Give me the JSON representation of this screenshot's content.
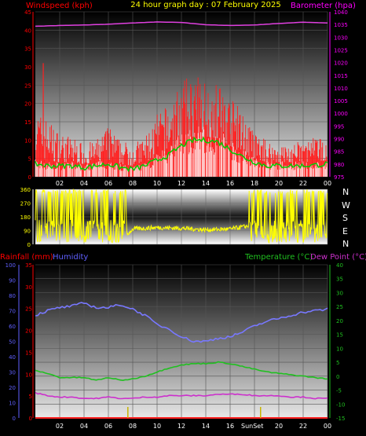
{
  "title": "24 hour graph day : 07 February 2025",
  "colors": {
    "wind": "#ff2020",
    "wind_avg": "#00cc00",
    "gust_fill": "#ffffff",
    "barometer": "#e040e0",
    "direction": "#ffff00",
    "humidity": "#7878ff",
    "temperature": "#20c020",
    "dewpoint": "#cc30cc",
    "rain": "#ff2020",
    "axis_left_top": "#ff0000",
    "axis_right_top": "#ff00ff",
    "axis_left_bottom_rain": "#ff0000",
    "axis_left_bottom_hum": "#6060ff",
    "axis_right_bottom": "#20c020",
    "xaxis": "#ffffff"
  },
  "labels": {
    "windspeed": "Windspeed (kph)",
    "barometer": "Barometer (hpa)",
    "rainfall": "Rainfall (mm)",
    "humidity": "Humidity",
    "temperature": "Temperature (°C)",
    "dewpoint": "Dew Point (°C)",
    "compass": [
      "N",
      "W",
      "S",
      "E",
      "N"
    ],
    "sunset": "SunSet"
  },
  "x_ticks": [
    "02",
    "04",
    "06",
    "08",
    "10",
    "12",
    "14",
    "16",
    "18",
    "20",
    "22",
    "00"
  ],
  "chart_data": [
    {
      "type": "line",
      "name": "wind-pressure",
      "x_range": [
        0,
        24
      ],
      "left_axis": {
        "label": "Windspeed (kph)",
        "ylim": [
          0,
          45
        ],
        "ticks": [
          0,
          5,
          10,
          15,
          20,
          25,
          30,
          35,
          40,
          45
        ]
      },
      "right_axis": {
        "label": "Barometer (hpa)",
        "ylim": [
          975,
          1040
        ],
        "ticks": [
          975,
          980,
          985,
          990,
          995,
          1000,
          1005,
          1010,
          1015,
          1020,
          1025,
          1030,
          1035,
          1040
        ]
      },
      "series": [
        {
          "name": "Barometer (hpa)",
          "axis": "right",
          "x": [
            0,
            2,
            4,
            6,
            8,
            10,
            12,
            14,
            16,
            18,
            20,
            22,
            24
          ],
          "values": [
            1034.3,
            1034.6,
            1034.8,
            1035.1,
            1035.6,
            1036,
            1035.8,
            1034.9,
            1034.6,
            1034.8,
            1035.4,
            1035.9,
            1035.6
          ]
        }
      ],
      "wind_envelope": {
        "x": [
          0,
          1,
          2,
          3,
          4,
          5,
          6,
          7,
          8,
          9,
          10,
          11,
          12,
          13,
          14,
          15,
          16,
          17,
          18,
          19,
          20,
          21,
          22,
          23,
          24
        ],
        "gust_peak": [
          18,
          16,
          12,
          11,
          9,
          10,
          14,
          10,
          9,
          11,
          17,
          20,
          26,
          28,
          27,
          26,
          22,
          18,
          12,
          10,
          9,
          9,
          10,
          11,
          10
        ],
        "average": [
          3.5,
          3,
          3,
          3,
          2.5,
          3,
          3.5,
          2.5,
          2,
          3,
          4.5,
          6,
          8.5,
          10,
          10,
          9.5,
          7.5,
          5.5,
          4,
          3,
          3,
          3,
          3,
          3.2,
          3.5
        ],
        "max_gust": 31
      }
    },
    {
      "type": "line",
      "name": "wind-direction",
      "x_range": [
        0,
        24
      ],
      "left_axis": {
        "ylim": [
          0,
          360
        ],
        "ticks": [
          0,
          90,
          180,
          270,
          360
        ]
      },
      "series": [
        {
          "name": "direction",
          "axis": "left",
          "x": [
            0,
            2,
            4,
            6,
            7.5,
            8,
            10,
            12,
            14,
            16,
            17.5,
            18,
            20,
            22,
            24
          ],
          "values": [
            120,
            150,
            200,
            180,
            60,
            100,
            110,
            105,
            95,
            100,
            120,
            70,
            90,
            80,
            40
          ]
        }
      ]
    },
    {
      "type": "line",
      "name": "temp-hum",
      "x_range": [
        0,
        24
      ],
      "left_axis_rain": {
        "label": "Rainfall (mm)",
        "ylim": [
          0,
          35
        ],
        "ticks": [
          0,
          5,
          10,
          15,
          20,
          25,
          30,
          35
        ]
      },
      "left_axis_hum": {
        "label": "Humidity",
        "ylim": [
          0,
          100
        ],
        "ticks": [
          0,
          10,
          20,
          30,
          40,
          50,
          60,
          70,
          80,
          90,
          100
        ]
      },
      "right_axis": {
        "label": "Temperature (°C)",
        "ylim": [
          -15,
          40
        ],
        "ticks": [
          -15,
          -10,
          -5,
          0,
          5,
          10,
          15,
          20,
          25,
          30,
          35,
          40
        ]
      },
      "series": [
        {
          "name": "Humidity",
          "axis": "humidity",
          "x": [
            0,
            1,
            2,
            3,
            4,
            5,
            6,
            7,
            8,
            9,
            10,
            11,
            12,
            13,
            14,
            15,
            16,
            17,
            18,
            19,
            20,
            21,
            22,
            23,
            24
          ],
          "values": [
            67,
            70,
            72,
            73,
            75,
            72,
            72,
            74,
            71,
            67,
            61,
            58,
            53,
            50,
            50,
            52,
            53,
            56,
            60,
            63,
            65,
            67,
            69,
            70,
            71
          ]
        },
        {
          "name": "Temperature (°C)",
          "axis": "right",
          "x": [
            0,
            1,
            2,
            3,
            4,
            5,
            6,
            7,
            8,
            9,
            10,
            11,
            12,
            13,
            14,
            15,
            16,
            17,
            18,
            19,
            20,
            21,
            22,
            23,
            24
          ],
          "values": [
            2,
            1,
            -0.5,
            -0.5,
            -0.5,
            -1.5,
            -0.5,
            -1.5,
            -1,
            0,
            1.5,
            3,
            4,
            4.5,
            4.5,
            5,
            4.5,
            3.5,
            2.5,
            1.5,
            1,
            0.5,
            0,
            -0.5,
            -1
          ]
        },
        {
          "name": "Dew Point (°C)",
          "axis": "right",
          "x": [
            0,
            1,
            2,
            3,
            4,
            5,
            6,
            7,
            8,
            9,
            10,
            11,
            12,
            13,
            14,
            15,
            16,
            17,
            18,
            19,
            20,
            21,
            22,
            23,
            24
          ],
          "values": [
            -6,
            -7,
            -7.5,
            -7.5,
            -8,
            -8,
            -7.5,
            -8,
            -8,
            -7.5,
            -7.5,
            -7,
            -7,
            -7,
            -7,
            -6.5,
            -6.5,
            -6.5,
            -7,
            -7,
            -7,
            -7.5,
            -7.5,
            -8,
            -8
          ]
        },
        {
          "name": "Rainfall (mm)",
          "axis": "rain",
          "x": [
            0,
            24
          ],
          "values": [
            0,
            0
          ]
        }
      ]
    }
  ]
}
